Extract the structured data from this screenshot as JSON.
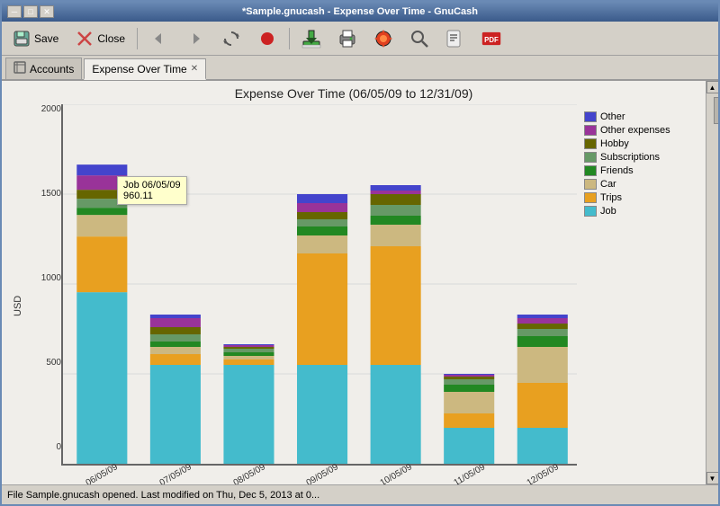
{
  "window": {
    "title": "*Sample.gnucash - Expense Over Time - GnuCash"
  },
  "toolbar": {
    "save_label": "Save",
    "close_label": "Close"
  },
  "tabs": [
    {
      "label": "Accounts",
      "active": false,
      "closeable": false
    },
    {
      "label": "Expense Over Time",
      "active": true,
      "closeable": true
    }
  ],
  "chart": {
    "title": "Expense Over Time (06/05/09 to 12/31/09)",
    "y_axis_label": "USD",
    "y_ticks": [
      "2000",
      "1500",
      "1000",
      "500",
      "0"
    ],
    "x_labels": [
      "06/05/09",
      "07/05/09",
      "08/05/09",
      "09/05/09",
      "10/05/09",
      "11/05/09",
      "12/05/09"
    ],
    "tooltip": {
      "label": "Job 06/05/09",
      "value": "960.11"
    },
    "legend": [
      {
        "label": "Other",
        "color": "#4444cc"
      },
      {
        "label": "Other expenses",
        "color": "#993399"
      },
      {
        "label": "Hobby",
        "color": "#666600"
      },
      {
        "label": "Subscriptions",
        "color": "#669966"
      },
      {
        "label": "Friends",
        "color": "#228822"
      },
      {
        "label": "Car",
        "color": "#ccb880"
      },
      {
        "label": "Trips",
        "color": "#e8a020"
      },
      {
        "label": "Job",
        "color": "#44bbcc"
      }
    ],
    "bars": [
      {
        "date": "06/05/09",
        "segments": [
          {
            "category": "Job",
            "value": 960,
            "color": "#44bbcc"
          },
          {
            "category": "Trips",
            "value": 310,
            "color": "#e8a020"
          },
          {
            "category": "Car",
            "value": 120,
            "color": "#ccb880"
          },
          {
            "category": "Friends",
            "value": 40,
            "color": "#228822"
          },
          {
            "category": "Subscriptions",
            "value": 50,
            "color": "#669966"
          },
          {
            "category": "Hobby",
            "value": 50,
            "color": "#666600"
          },
          {
            "category": "Other expenses",
            "value": 80,
            "color": "#993399"
          },
          {
            "category": "Other",
            "value": 60,
            "color": "#4444cc"
          }
        ],
        "total": 1670
      },
      {
        "date": "07/05/09",
        "segments": [
          {
            "category": "Job",
            "value": 550,
            "color": "#44bbcc"
          },
          {
            "category": "Trips",
            "value": 60,
            "color": "#e8a020"
          },
          {
            "category": "Car",
            "value": 40,
            "color": "#ccb880"
          },
          {
            "category": "Friends",
            "value": 30,
            "color": "#228822"
          },
          {
            "category": "Subscriptions",
            "value": 40,
            "color": "#669966"
          },
          {
            "category": "Hobby",
            "value": 40,
            "color": "#666600"
          },
          {
            "category": "Other expenses",
            "value": 50,
            "color": "#993399"
          },
          {
            "category": "Other",
            "value": 20,
            "color": "#4444cc"
          }
        ],
        "total": 830
      },
      {
        "date": "08/05/09",
        "segments": [
          {
            "category": "Job",
            "value": 550,
            "color": "#44bbcc"
          },
          {
            "category": "Trips",
            "value": 30,
            "color": "#e8a020"
          },
          {
            "category": "Car",
            "value": 20,
            "color": "#ccb880"
          },
          {
            "category": "Friends",
            "value": 20,
            "color": "#228822"
          },
          {
            "category": "Subscriptions",
            "value": 20,
            "color": "#669966"
          },
          {
            "category": "Hobby",
            "value": 10,
            "color": "#666600"
          },
          {
            "category": "Other expenses",
            "value": 10,
            "color": "#993399"
          },
          {
            "category": "Other",
            "value": 5,
            "color": "#4444cc"
          }
        ],
        "total": 665
      },
      {
        "date": "09/05/09",
        "segments": [
          {
            "category": "Job",
            "value": 550,
            "color": "#44bbcc"
          },
          {
            "category": "Trips",
            "value": 620,
            "color": "#e8a020"
          },
          {
            "category": "Car",
            "value": 100,
            "color": "#ccb880"
          },
          {
            "category": "Friends",
            "value": 50,
            "color": "#228822"
          },
          {
            "category": "Subscriptions",
            "value": 40,
            "color": "#669966"
          },
          {
            "category": "Hobby",
            "value": 40,
            "color": "#666600"
          },
          {
            "category": "Other expenses",
            "value": 50,
            "color": "#993399"
          },
          {
            "category": "Other",
            "value": 50,
            "color": "#4444cc"
          }
        ],
        "total": 1500
      },
      {
        "date": "10/05/09",
        "segments": [
          {
            "category": "Job",
            "value": 550,
            "color": "#44bbcc"
          },
          {
            "category": "Trips",
            "value": 660,
            "color": "#e8a020"
          },
          {
            "category": "Car",
            "value": 120,
            "color": "#ccb880"
          },
          {
            "category": "Friends",
            "value": 50,
            "color": "#228822"
          },
          {
            "category": "Subscriptions",
            "value": 60,
            "color": "#669966"
          },
          {
            "category": "Hobby",
            "value": 60,
            "color": "#666600"
          },
          {
            "category": "Other expenses",
            "value": 20,
            "color": "#993399"
          },
          {
            "category": "Other",
            "value": 30,
            "color": "#4444cc"
          }
        ],
        "total": 1550
      },
      {
        "date": "11/05/09",
        "segments": [
          {
            "category": "Job",
            "value": 200,
            "color": "#44bbcc"
          },
          {
            "category": "Trips",
            "value": 80,
            "color": "#e8a020"
          },
          {
            "category": "Car",
            "value": 120,
            "color": "#ccb880"
          },
          {
            "category": "Friends",
            "value": 40,
            "color": "#228822"
          },
          {
            "category": "Subscriptions",
            "value": 30,
            "color": "#669966"
          },
          {
            "category": "Hobby",
            "value": 15,
            "color": "#666600"
          },
          {
            "category": "Other expenses",
            "value": 10,
            "color": "#993399"
          },
          {
            "category": "Other",
            "value": 5,
            "color": "#4444cc"
          }
        ],
        "total": 500
      },
      {
        "date": "12/05/09",
        "segments": [
          {
            "category": "Job",
            "value": 200,
            "color": "#44bbcc"
          },
          {
            "category": "Trips",
            "value": 250,
            "color": "#e8a020"
          },
          {
            "category": "Car",
            "value": 200,
            "color": "#ccb880"
          },
          {
            "category": "Friends",
            "value": 60,
            "color": "#228822"
          },
          {
            "category": "Subscriptions",
            "value": 40,
            "color": "#669966"
          },
          {
            "category": "Hobby",
            "value": 30,
            "color": "#666600"
          },
          {
            "category": "Other expenses",
            "value": 30,
            "color": "#993399"
          },
          {
            "category": "Other",
            "value": 20,
            "color": "#4444cc"
          }
        ],
        "total": 830
      }
    ]
  },
  "status_bar": {
    "text": "File Sample.gnucash opened. Last modified on Thu, Dec  5, 2013 at 0..."
  }
}
